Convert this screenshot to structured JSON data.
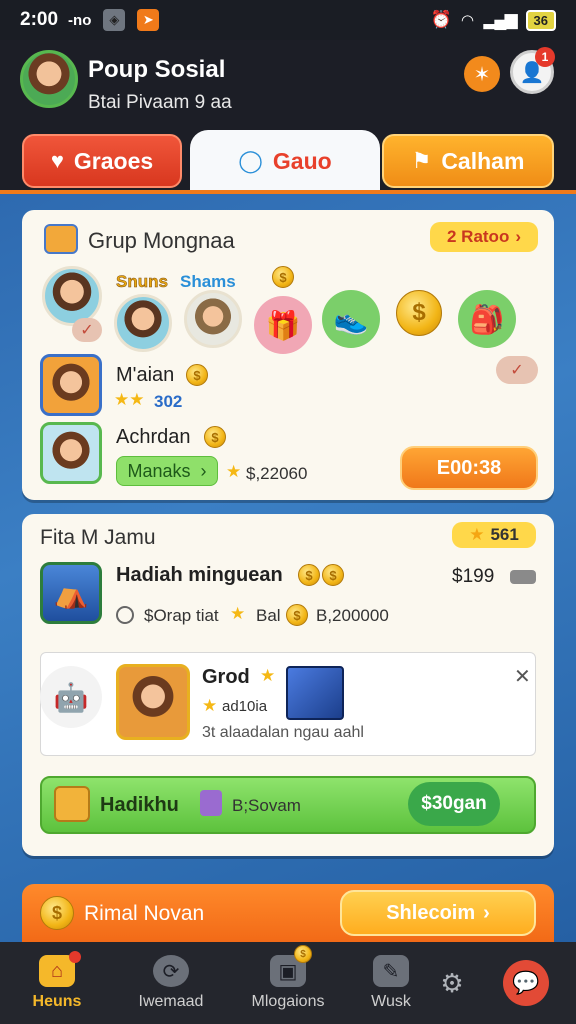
{
  "status_bar": {
    "time": "2:00",
    "extra": "-no",
    "battery": "36"
  },
  "header": {
    "title": "Poup Sosial",
    "subtitle": "Btai Pivaam 9 aa",
    "notification_count": "1"
  },
  "tabs": [
    {
      "label": "Graoes",
      "icon": "heart-icon"
    },
    {
      "label": "Gauo",
      "icon": "chat-bubble-icon"
    },
    {
      "label": "Calham",
      "icon": "flag-icon"
    }
  ],
  "group_card": {
    "title": "Grup Mongnaa",
    "badge": "2 Ratoo",
    "label_yellow": "Snuns",
    "label_blue": "Shams",
    "member1": {
      "name": "M'aian",
      "rating": "302"
    },
    "member2": {
      "name": "Achrdan",
      "action_label": "Manaks",
      "score": "$,22060"
    },
    "timer": "E00:38"
  },
  "task_card": {
    "title": "Fita M Jamu",
    "badge": "561",
    "task1": {
      "title": "Hadiah minguean",
      "price": "$199",
      "meta1": "$Orap tiat",
      "meta2": "Bal",
      "meta3": "B,200000"
    },
    "task2": {
      "title": "Grod",
      "subtitle": "ad10ia",
      "description": "3t alaadalan ngau aahl"
    },
    "reward": {
      "label": "Hadikhu",
      "sub": "B;Sovam",
      "price": "$30gan"
    }
  },
  "banner": {
    "label": "Rimal Novan",
    "button": "Shlecoim"
  },
  "bottom_nav": [
    {
      "label": "Heuns",
      "icon": "home-icon",
      "active": true
    },
    {
      "label": "Iwemaad",
      "icon": "refresh-icon",
      "active": false
    },
    {
      "label": "Mlogaions",
      "icon": "gallery-icon",
      "active": false
    },
    {
      "label": "Wusk",
      "icon": "edit-icon",
      "active": false
    }
  ],
  "colors": {
    "accent_orange": "#f07a1a",
    "accent_red": "#e8402b",
    "accent_green": "#5dc23d",
    "background_blue": "#2e6ab0"
  }
}
